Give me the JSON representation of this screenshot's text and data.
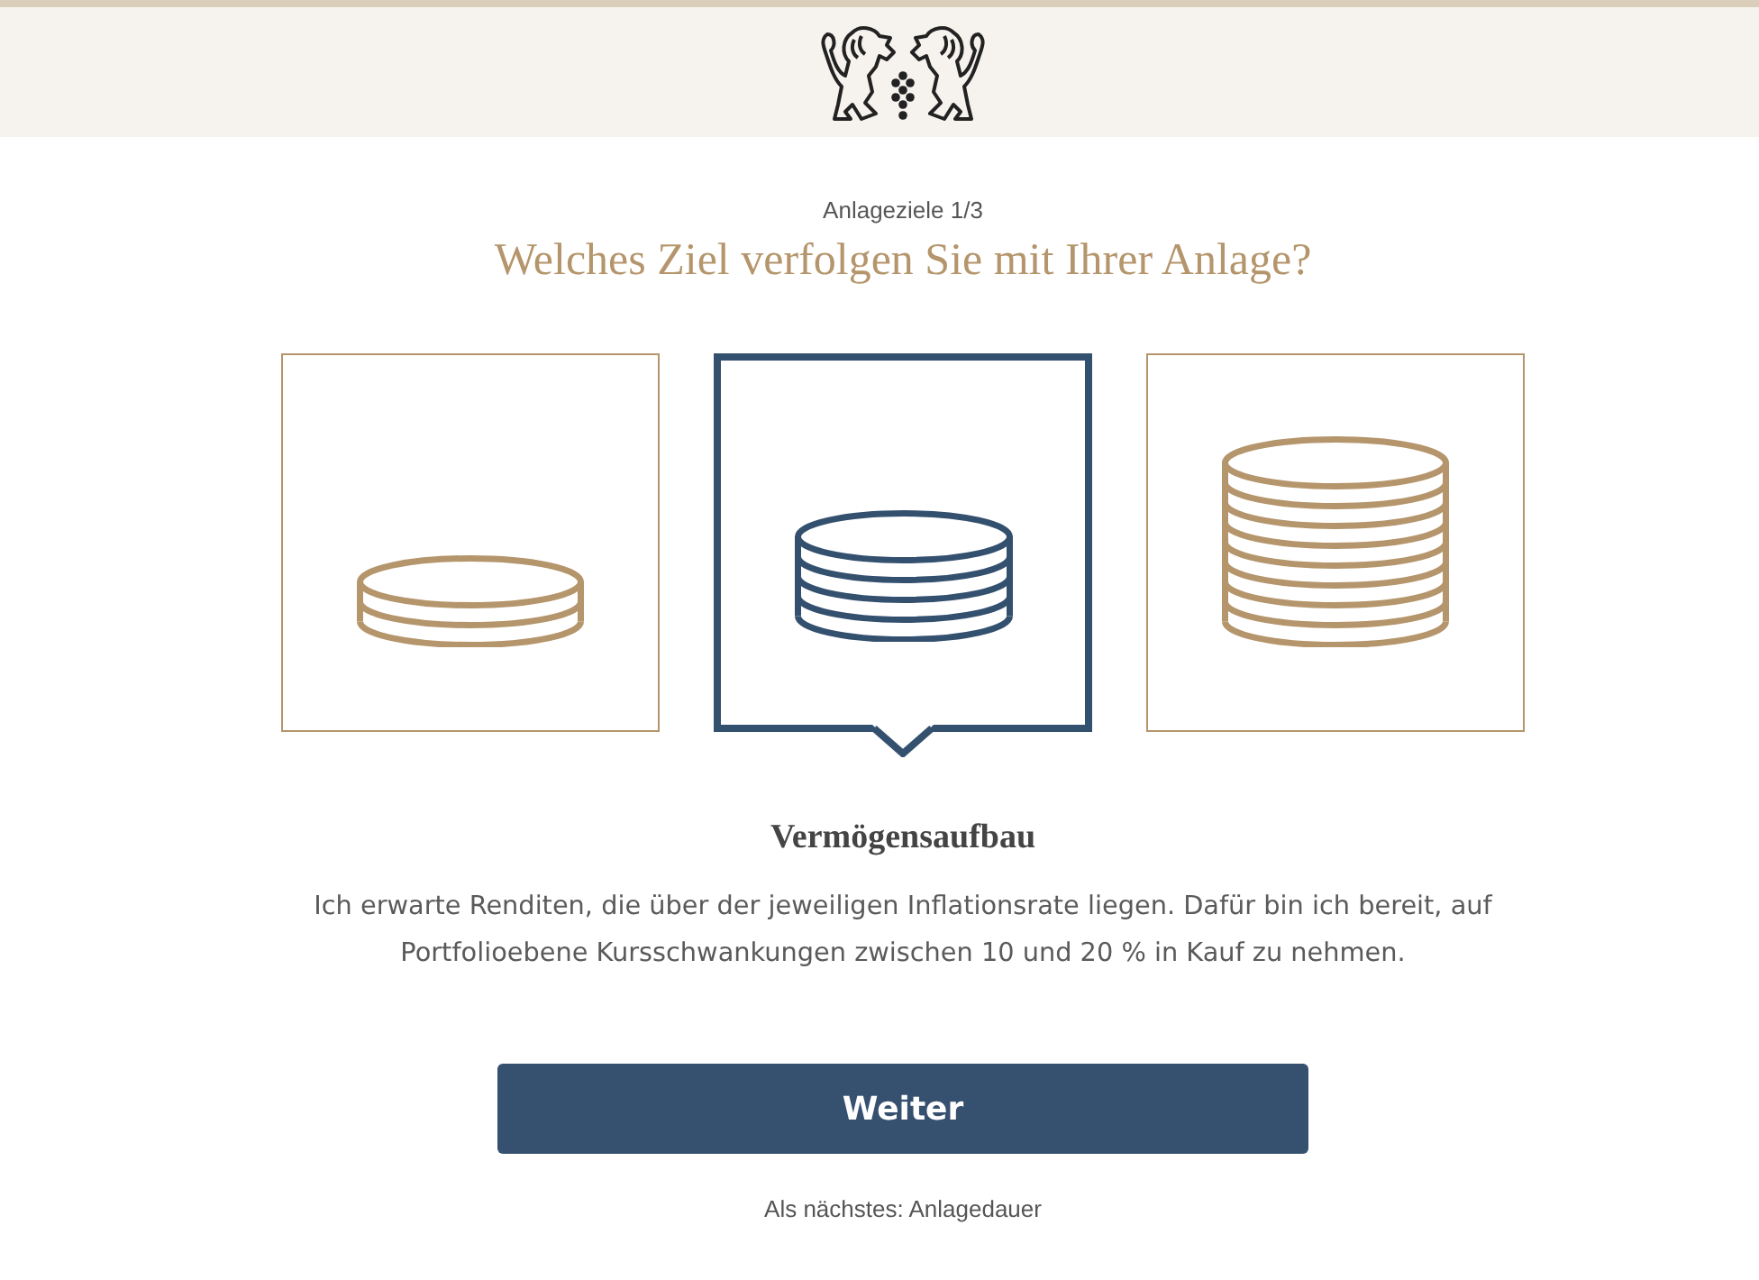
{
  "step_label": "Anlageziele 1/3",
  "question": "Welches Ziel verfolgen Sie mit Ihrer Anlage?",
  "options": [
    {
      "kind": "small",
      "selected": false
    },
    {
      "kind": "medium",
      "selected": true
    },
    {
      "kind": "large",
      "selected": false
    }
  ],
  "selected_option": {
    "title": "Vermögensaufbau",
    "description": "Ich erwarte Renditen, die über der jeweiligen Inflationsrate liegen. Dafür bin ich bereit, auf Portfolioebene Kursschwankungen zwischen 10 und 20 % in Kauf zu nehmen."
  },
  "next_button": "Weiter",
  "next_step": "Als nächstes: Anlagedauer"
}
